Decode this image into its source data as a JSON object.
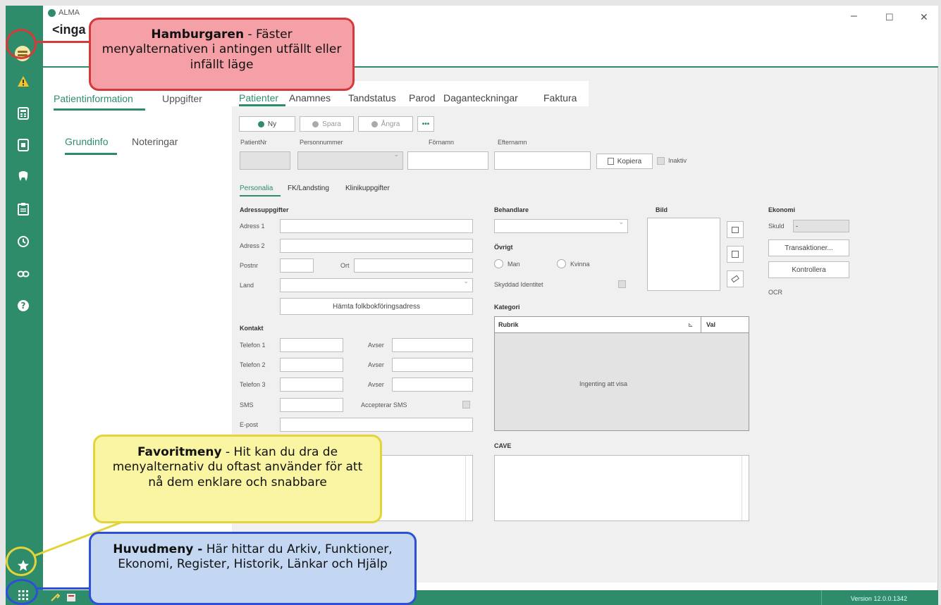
{
  "app": {
    "title": "ALMA",
    "patient_name": "<inga",
    "win_minimize": "–",
    "win_maximize": "☐",
    "win_close": "✕"
  },
  "left_tabs": [
    "Patientinformation",
    "Uppgifter"
  ],
  "left_subtabs": [
    "Grundinfo",
    "Noteringar"
  ],
  "main_tabs": [
    "Patienter",
    "Anamnes",
    "Tandstatus",
    "Parod",
    "Daganteckningar",
    "Faktura"
  ],
  "toolbar": {
    "new": "Ny",
    "save": "Spara",
    "undo": "Ångra",
    "more": "•••"
  },
  "identity": {
    "patientnr_label": "PatientNr",
    "personnummer_label": "Personnummer",
    "fornamn_label": "Förnamn",
    "efternamn_label": "Efternamn",
    "copy_button": "Kopiera",
    "inactive_label": "Inaktiv"
  },
  "sub_tabs": [
    "Personalia",
    "FK/Landsting",
    "Klinikuppgifter"
  ],
  "address": {
    "header": "Adressuppgifter",
    "adress1": "Adress 1",
    "adress2": "Adress 2",
    "postnr": "Postnr",
    "ort": "Ort",
    "land": "Land",
    "fetch_button": "Hämta folkbokföringsadress"
  },
  "contact": {
    "header": "Kontakt",
    "tel1": "Telefon 1",
    "tel2": "Telefon 2",
    "tel3": "Telefon 3",
    "avser": "Avser",
    "sms": "SMS",
    "accept_sms": "Accepterar SMS",
    "email": "E-post"
  },
  "behandlare": {
    "header": "Behandlare"
  },
  "ovrigt": {
    "header": "Övrigt",
    "man": "Man",
    "kvinna": "Kvinna",
    "skyddad": "Skyddad Identitet"
  },
  "bild": {
    "header": "Bild"
  },
  "ekonomi": {
    "header": "Ekonomi",
    "skuld": "Skuld",
    "skuld_value": "-",
    "transaktioner": "Transaktioner...",
    "kontrollera": "Kontrollera",
    "ocr": "OCR"
  },
  "kategori": {
    "header": "Kategori",
    "col_rubrik": "Rubrik",
    "col_val": "Val",
    "empty": "Ingenting att visa"
  },
  "cave": {
    "header": "CAVE"
  },
  "status": {
    "version": "Version 12.0.0.1342"
  },
  "callouts": {
    "hamburger": {
      "title": "Hamburgaren",
      "text": " - Fäster menyalternativen i antingen utfällt eller infällt läge"
    },
    "favorite": {
      "title": "Favoritmeny",
      "text": " - Hit kan du dra de menyalternativ du oftast använder för att nå dem enklare och snabbare"
    },
    "main_menu": {
      "title": "Huvudmeny -",
      "text": " Här hittar du Arkiv, Funktioner, Ekonomi, Register, Historik, Länkar och Hjälp"
    }
  },
  "colors": {
    "brand_green": "#2f8c6b",
    "callout_red": "#f4a0a6",
    "callout_yellow": "#faf5a2",
    "callout_blue": "#c3d7f3"
  },
  "icons": {
    "sidebar": [
      "hamburger-icon",
      "warning-icon",
      "calculator-icon",
      "id-card-icon",
      "tooth-icon",
      "clipboard-icon",
      "history-icon",
      "link-icon",
      "help-icon",
      "star-icon",
      "apps-grid-icon"
    ]
  }
}
